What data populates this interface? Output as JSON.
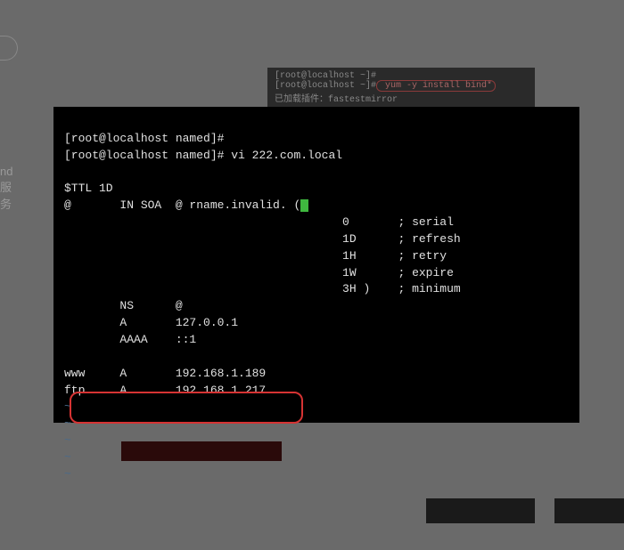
{
  "background": {
    "fragment1": "nd服务",
    "fragment2": "yum -y install bind*",
    "ghost_line1": "[root@localhost ~]#",
    "ghost_line2_prefix": "[root@localhost ~]#",
    "ghost_line2_cmd": " yum -y install bind*",
    "ghost_line3": "已加载插件：fastestmirror"
  },
  "terminal": {
    "line1": "[root@localhost named]#",
    "line2_prompt": "[root@localhost named]# ",
    "line2_cmd": "vi 222.com.local",
    "blank1": "",
    "ttl": "$TTL 1D",
    "soa_line": "@       IN SOA  @ rname.invalid. (",
    "soa_serial": "                                        0       ; serial",
    "soa_refresh": "                                        1D      ; refresh",
    "soa_retry": "                                        1H      ; retry",
    "soa_expire": "                                        1W      ; expire",
    "soa_minimum": "                                        3H )    ; minimum",
    "ns_line": "        NS      @",
    "a_line": "        A       127.0.0.1",
    "aaaa_line": "        AAAA    ::1",
    "blank2": "",
    "www_line": "www     A       192.168.1.189",
    "ftp_line": "ftp     A       192.168.1.217",
    "tilde1": "~",
    "tilde2": "~",
    "tilde3": "~",
    "tilde4": "~",
    "tilde5": "~"
  }
}
